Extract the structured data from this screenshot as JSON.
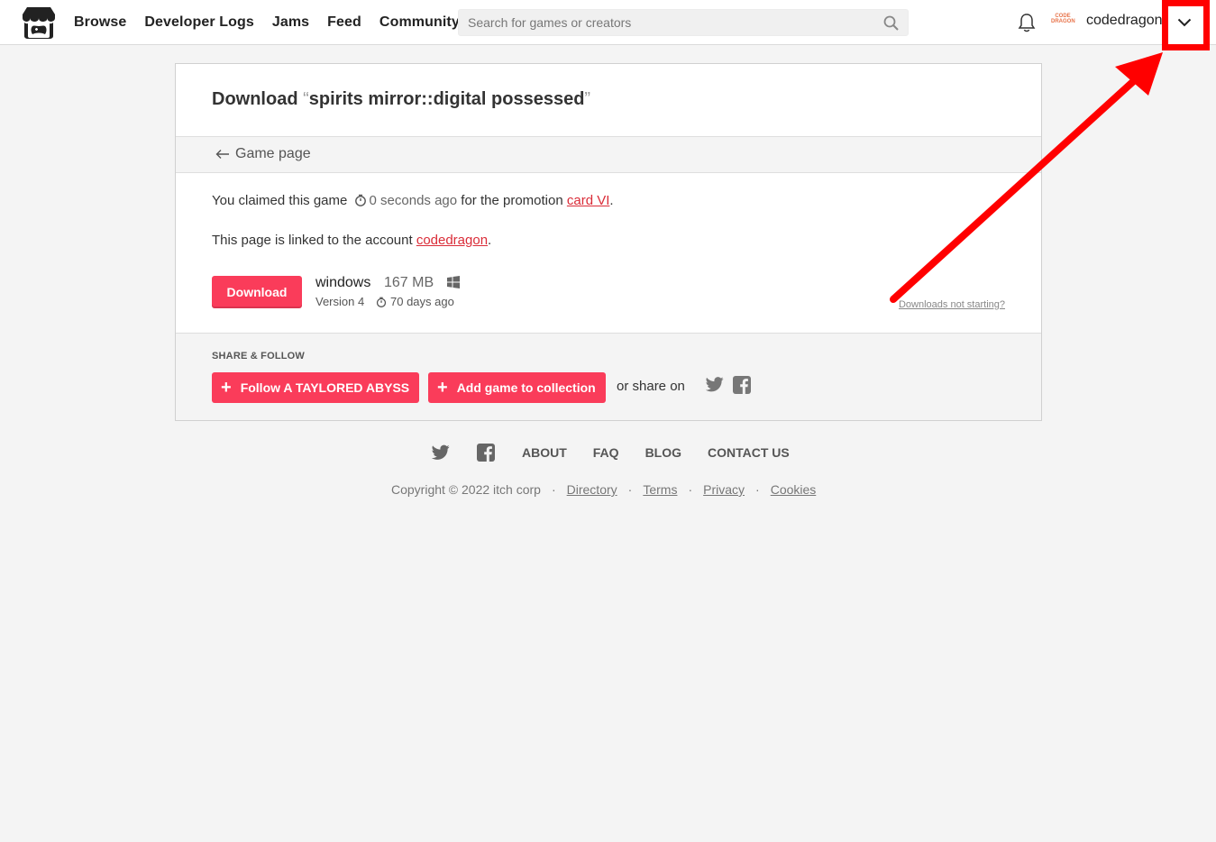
{
  "header": {
    "nav": [
      "Browse",
      "Developer Logs",
      "Jams",
      "Feed",
      "Community"
    ],
    "search_placeholder": "Search for games or creators",
    "avatar_text": "CODE DRAGON",
    "username": "codedragon"
  },
  "card": {
    "title_prefix": "Download",
    "open_quote": "“",
    "game_name": "spirits mirror::digital possessed",
    "close_quote": "”",
    "back_link": "Game page",
    "claim_text_1": "You claimed this game",
    "claim_time": "0 seconds ago",
    "claim_text_2": "for the promotion",
    "promotion": "card VI",
    "period": ".",
    "linked_text": "This page is linked to the account",
    "linked_account": "codedragon",
    "download_label": "Download",
    "file": {
      "name": "windows",
      "size": "167 MB",
      "version": "Version 4",
      "age": "70 days ago"
    },
    "help_link": "Downloads not starting?",
    "share_heading": "SHARE & FOLLOW",
    "follow_label": "Follow A TAYLORED ABYSS",
    "collection_label": "Add game to collection",
    "share_on": "or share on"
  },
  "footer": {
    "links": [
      "ABOUT",
      "FAQ",
      "BLOG",
      "CONTACT US"
    ],
    "copyright": "Copyright © 2022 itch corp",
    "legal": [
      "Directory",
      "Terms",
      "Privacy",
      "Cookies"
    ],
    "separator": "·"
  },
  "colors": {
    "accent": "#fa3c5a",
    "link": "#da2c38",
    "annotation": "#ff0000"
  },
  "icons": [
    "itchio-logo-icon",
    "search-icon",
    "bell-icon",
    "chevron-down-icon",
    "timer-icon",
    "windows-icon",
    "plus-icon",
    "twitter-icon",
    "facebook-icon",
    "arrow-left-icon"
  ]
}
